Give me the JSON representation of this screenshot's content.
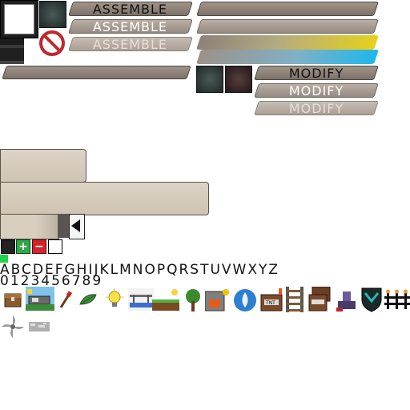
{
  "assemble": {
    "normal": "ASSEMBLE",
    "hover": "ASSEMBLE",
    "disabled": "ASSEMBLE"
  },
  "modify": {
    "normal": "MODIFY",
    "hover": "MODIFY",
    "disabled": "MODIFY"
  },
  "font": {
    "letters": "ABCDEFGHIJKLMNOPQRSTUVWXYZ",
    "digits": "0123456789"
  },
  "colors": {
    "gauge_yellow": "#e6d21a",
    "gauge_blue": "#1fb7ea",
    "plus_green": "#2fa84a",
    "minus_red": "#d4232b"
  },
  "icons": [
    "chest-icon",
    "minecart-icon",
    "torch-icon",
    "leaf-icon",
    "lamp-icon",
    "rail-bridge-icon",
    "farmland-icon",
    "tree-icon",
    "furnace-icon",
    "water-icon",
    "tnt-icon",
    "ladder-rail-icon",
    "tnt-stack-icon",
    "anvil-icon",
    "shield-icon",
    "fence-icon",
    "fan-icon",
    "dust-icon"
  ]
}
